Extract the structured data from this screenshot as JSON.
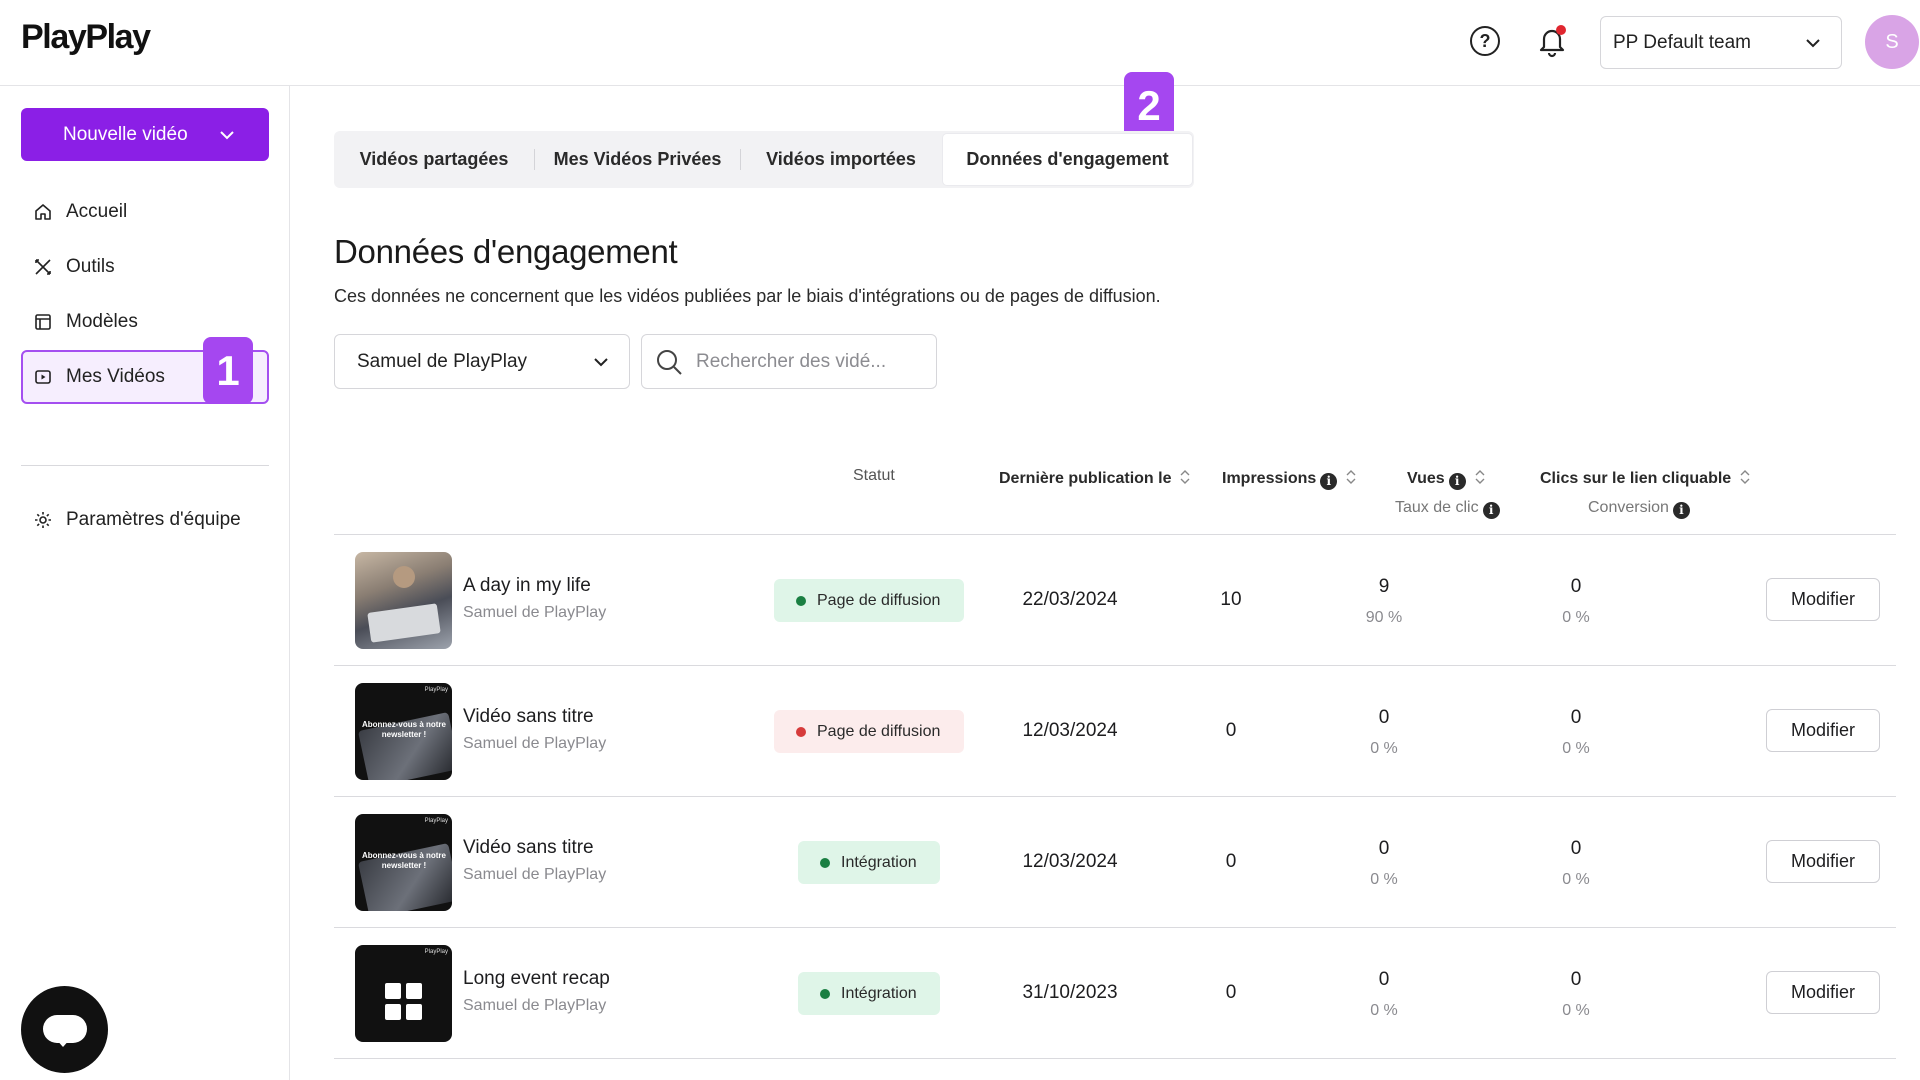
{
  "app": {
    "logo": "PlayPlay"
  },
  "topbar": {
    "help_icon": "question-circle-icon",
    "bell_icon": "bell-icon",
    "team_select": "PP Default team",
    "avatar_initial": "S"
  },
  "sidebar": {
    "new_video_label": "Nouvelle vidéo",
    "items": [
      {
        "label": "Accueil",
        "icon": "home-icon"
      },
      {
        "label": "Outils",
        "icon": "tools-icon"
      },
      {
        "label": "Modèles",
        "icon": "template-icon"
      },
      {
        "label": "Mes Vidéos",
        "icon": "video-icon",
        "active": true
      },
      {
        "label": "Paramètres d'équipe",
        "icon": "gear-icon"
      }
    ]
  },
  "steps": {
    "step1": "1",
    "step2": "2"
  },
  "tabs": [
    {
      "label": "Vidéos partagées"
    },
    {
      "label": "Mes Vidéos Privées"
    },
    {
      "label": "Vidéos importées"
    },
    {
      "label": "Données d'engagement",
      "active": true
    }
  ],
  "page": {
    "title": "Données d'engagement",
    "subtitle": "Ces données ne concernent que les vidéos publiées par le biais d'intégrations ou de pages de diffusion."
  },
  "filters": {
    "author": "Samuel de PlayPlay",
    "search_placeholder": "Rechercher des vidé..."
  },
  "table": {
    "headers": {
      "status": "Statut",
      "last_published": "Dernière publication le",
      "impressions": "Impressions",
      "views": "Vues",
      "views_sub": "Taux de clic",
      "clicks": "Clics sur le lien cliquable",
      "clicks_sub": "Conversion"
    },
    "rows": [
      {
        "title": "A day in my life",
        "author": "Samuel de PlayPlay",
        "status": "Page de diffusion",
        "status_color": "#1f9d55",
        "date": "22/03/2024",
        "impressions": "10",
        "views": "9",
        "ctr": "90 %",
        "clicks": "0",
        "conversion": "0 %",
        "action": "Modifier"
      },
      {
        "title": "Vidéo sans titre",
        "author": "Samuel de PlayPlay",
        "status": "Page de diffusion",
        "status_color": "#d63b3b",
        "date": "12/03/2024",
        "impressions": "0",
        "views": "0",
        "ctr": "0 %",
        "clicks": "0",
        "conversion": "0 %",
        "action": "Modifier"
      },
      {
        "title": "Vidéo sans titre",
        "author": "Samuel de PlayPlay",
        "status": "Intégration",
        "status_color": "#1f9d55",
        "date": "12/03/2024",
        "impressions": "0",
        "views": "0",
        "ctr": "0 %",
        "clicks": "0",
        "conversion": "0 %",
        "action": "Modifier"
      },
      {
        "title": "Long event recap",
        "author": "Samuel de PlayPlay",
        "status": "Intégration",
        "status_color": "#1f9d55",
        "date": "31/10/2023",
        "impressions": "0",
        "views": "0",
        "ctr": "0 %",
        "clicks": "0",
        "conversion": "0 %",
        "action": "Modifier"
      }
    ],
    "thumb_texts": {
      "newsletter": "Abonnez-vous à notre newsletter !",
      "brand": "PlayPlay"
    }
  },
  "colors": {
    "accent": "#8b1fe6",
    "badge": "#a547f0",
    "active_border": "#a44ff0"
  }
}
